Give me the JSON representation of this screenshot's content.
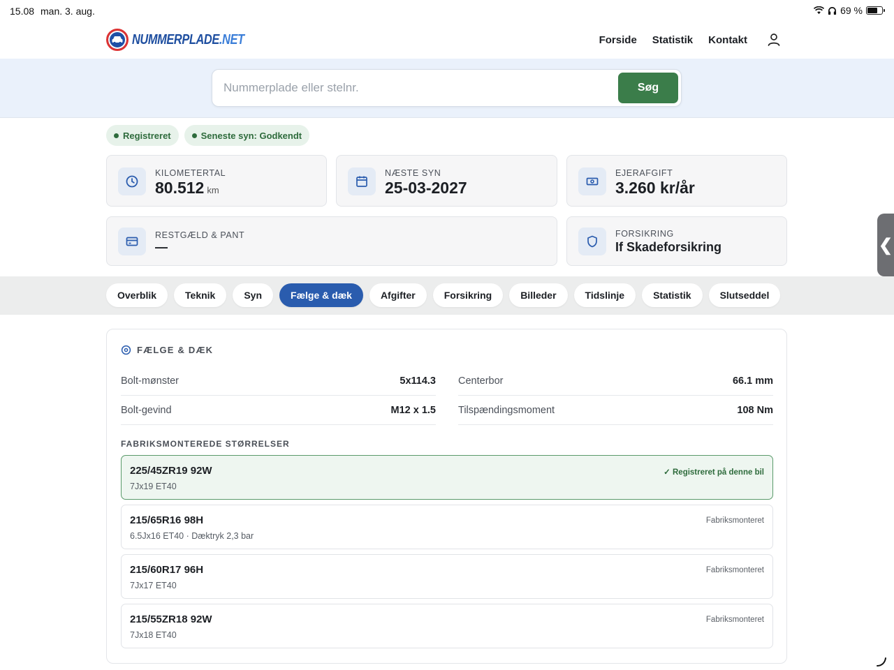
{
  "status": {
    "time": "15.08",
    "date": "man. 3. aug.",
    "battery": "69 %",
    "battery_level": 0.69
  },
  "header": {
    "logo_main": "NUMMERPLADE",
    "logo_suffix": ".NET",
    "nav": [
      "Forside",
      "Statistik",
      "Kontakt"
    ]
  },
  "search": {
    "placeholder": "Nummerplade eller stelnr.",
    "value": "",
    "button": "Søg"
  },
  "badges": [
    "Registreret",
    "Seneste syn: Godkendt"
  ],
  "cards": {
    "km": {
      "label": "KILOMETERTAL",
      "value": "80.512",
      "unit": "km"
    },
    "syn": {
      "label": "NÆSTE SYN",
      "value": "25-03-2027"
    },
    "afgift": {
      "label": "EJERAFGIFT",
      "value": "3.260 kr/år"
    },
    "gaeld": {
      "label": "RESTGÆLD & PANT",
      "value": "—"
    },
    "forsikring": {
      "label": "FORSIKRING",
      "value": "If Skadeforsikring"
    }
  },
  "tabs": [
    "Overblik",
    "Teknik",
    "Syn",
    "Fælge & dæk",
    "Afgifter",
    "Forsikring",
    "Billeder",
    "Tidslinje",
    "Statistik",
    "Slutseddel"
  ],
  "active_tab": "Fælge & dæk",
  "panel": {
    "title": "FÆLGE & DÆK",
    "specs": {
      "bolt_pattern": {
        "label": "Bolt-mønster",
        "value": "5x114.3"
      },
      "center_bore": {
        "label": "Centerbor",
        "value": "66.1 mm"
      },
      "bolt_thread": {
        "label": "Bolt-gevind",
        "value": "M12 x 1.5"
      },
      "torque": {
        "label": "Tilspændingsmoment",
        "value": "108 Nm"
      }
    },
    "sizes_heading": "FABRIKSMONTEREDE STØRRELSER",
    "sizes": [
      {
        "tire": "225/45ZR19 92W",
        "rim": "7Jx19 ET40",
        "tag": "✓ Registreret på denne bil"
      },
      {
        "tire": "215/65R16 98H",
        "rim": "6.5Jx16 ET40 · Dæktryk 2,3 bar",
        "tag": "Fabriksmonteret"
      },
      {
        "tire": "215/60R17 96H",
        "rim": "7Jx17 ET40",
        "tag": "Fabriksmonteret"
      },
      {
        "tire": "215/55ZR18 92W",
        "rim": "7Jx18 ET40",
        "tag": "Fabriksmonteret"
      }
    ]
  },
  "colors": {
    "accent": "#2a5cae",
    "success": "#3b7d4a",
    "brand": "#1f4fa0"
  },
  "icons": [
    "wifi-icon",
    "headphones-icon",
    "battery-icon",
    "car-icon",
    "user-icon",
    "clock-icon",
    "calendar-icon",
    "money-icon",
    "card-icon",
    "shield-icon",
    "wheel-icon",
    "chevron-left-icon",
    "resize-icon"
  ]
}
